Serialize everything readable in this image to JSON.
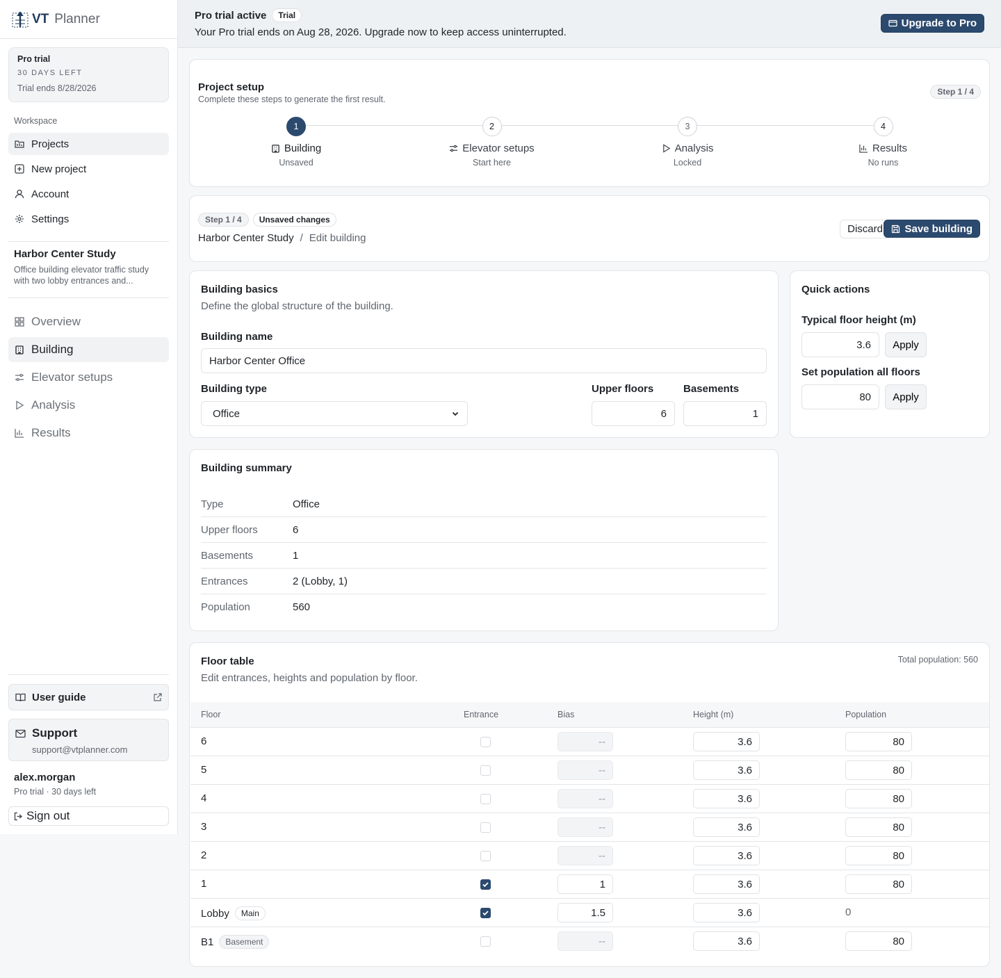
{
  "brand": {
    "vt": "VT",
    "planner": "Planner"
  },
  "trial_box": {
    "title": "Pro trial",
    "days_left": "30 DAYS LEFT",
    "ends": "Trial ends 8/28/2026"
  },
  "workspace": {
    "label": "Workspace",
    "items": [
      {
        "label": "Projects",
        "icon": "folder-icon"
      },
      {
        "label": "New project",
        "icon": "plus-square-icon"
      },
      {
        "label": "Account",
        "icon": "user-icon"
      },
      {
        "label": "Settings",
        "icon": "gear-icon"
      }
    ]
  },
  "project": {
    "title": "Harbor Center Study",
    "description": "Office building elevator traffic study with two lobby entrances and...",
    "nav": [
      {
        "label": "Overview",
        "icon": "grid-icon"
      },
      {
        "label": "Building",
        "icon": "building-icon"
      },
      {
        "label": "Elevator setups",
        "icon": "sliders-icon"
      },
      {
        "label": "Analysis",
        "icon": "play-icon"
      },
      {
        "label": "Results",
        "icon": "bar-chart-icon"
      }
    ]
  },
  "footer": {
    "guide": "User guide",
    "support_title": "Support",
    "support_email": "support@vtplanner.com",
    "user_name": "alex.morgan",
    "user_sub": "Pro trial · 30 days left",
    "sign_out": "Sign out"
  },
  "banner": {
    "title": "Pro trial active",
    "badge": "Trial",
    "text": "Your Pro trial ends on Aug 28, 2026. Upgrade now to keep access uninterrupted.",
    "upgrade": "Upgrade to Pro"
  },
  "setup": {
    "title": "Project setup",
    "subtitle": "Complete these steps to generate the first result.",
    "step_pill": "Step 1 / 4",
    "steps": [
      {
        "num": "1",
        "label": "Building",
        "status": "Unsaved",
        "icon": "building-icon"
      },
      {
        "num": "2",
        "label": "Elevator setups",
        "status": "Start here",
        "icon": "sliders-icon"
      },
      {
        "num": "3",
        "label": "Analysis",
        "status": "Locked",
        "icon": "play-icon"
      },
      {
        "num": "4",
        "label": "Results",
        "status": "No runs",
        "icon": "bar-chart-icon"
      }
    ]
  },
  "edit_header": {
    "step_pill": "Step 1 / 4",
    "unsaved": "Unsaved changes",
    "crumb_project": "Harbor Center Study",
    "crumb_sep": "/",
    "crumb_page": "Edit building",
    "discard": "Discard",
    "save": "Save building"
  },
  "basics": {
    "title": "Building basics",
    "subtitle": "Define the global structure of the building.",
    "name_label": "Building name",
    "name_value": "Harbor Center Office",
    "type_label": "Building type",
    "type_value": "Office",
    "upper_label": "Upper floors",
    "upper_value": "6",
    "basements_label": "Basements",
    "basements_value": "1"
  },
  "quick": {
    "title": "Quick actions",
    "height_label": "Typical floor height (m)",
    "height_value": "3.6",
    "pop_label": "Set population all floors",
    "pop_value": "80",
    "apply": "Apply"
  },
  "summary": {
    "title": "Building summary",
    "rows": [
      {
        "k": "Type",
        "v": "Office"
      },
      {
        "k": "Upper floors",
        "v": "6"
      },
      {
        "k": "Basements",
        "v": "1"
      },
      {
        "k": "Entrances",
        "v": "2 (Lobby, 1)"
      },
      {
        "k": "Population",
        "v": "560"
      }
    ]
  },
  "floor_table": {
    "title": "Floor table",
    "subtitle": "Edit entrances, heights and population by floor.",
    "total": "Total population: 560",
    "headers": {
      "floor": "Floor",
      "entrance": "Entrance",
      "bias": "Bias",
      "height": "Height (m)",
      "population": "Population"
    },
    "rows": [
      {
        "floor": "6",
        "tag": "",
        "entrance": false,
        "bias": "--",
        "height": "3.6",
        "population": "80"
      },
      {
        "floor": "5",
        "tag": "",
        "entrance": false,
        "bias": "--",
        "height": "3.6",
        "population": "80"
      },
      {
        "floor": "4",
        "tag": "",
        "entrance": false,
        "bias": "--",
        "height": "3.6",
        "population": "80"
      },
      {
        "floor": "3",
        "tag": "",
        "entrance": false,
        "bias": "--",
        "height": "3.6",
        "population": "80"
      },
      {
        "floor": "2",
        "tag": "",
        "entrance": false,
        "bias": "--",
        "height": "3.6",
        "population": "80"
      },
      {
        "floor": "1",
        "tag": "",
        "entrance": true,
        "bias": "1",
        "height": "3.6",
        "population": "80"
      },
      {
        "floor": "Lobby",
        "tag": "Main",
        "entrance": true,
        "bias": "1.5",
        "height": "3.6",
        "population": "0"
      },
      {
        "floor": "B1",
        "tag": "Basement",
        "entrance": false,
        "bias": "--",
        "height": "3.6",
        "population": "80"
      }
    ]
  },
  "colors": {
    "primary": "#2c4a6e",
    "border": "#e3e5e8",
    "muted": "#60666e"
  }
}
